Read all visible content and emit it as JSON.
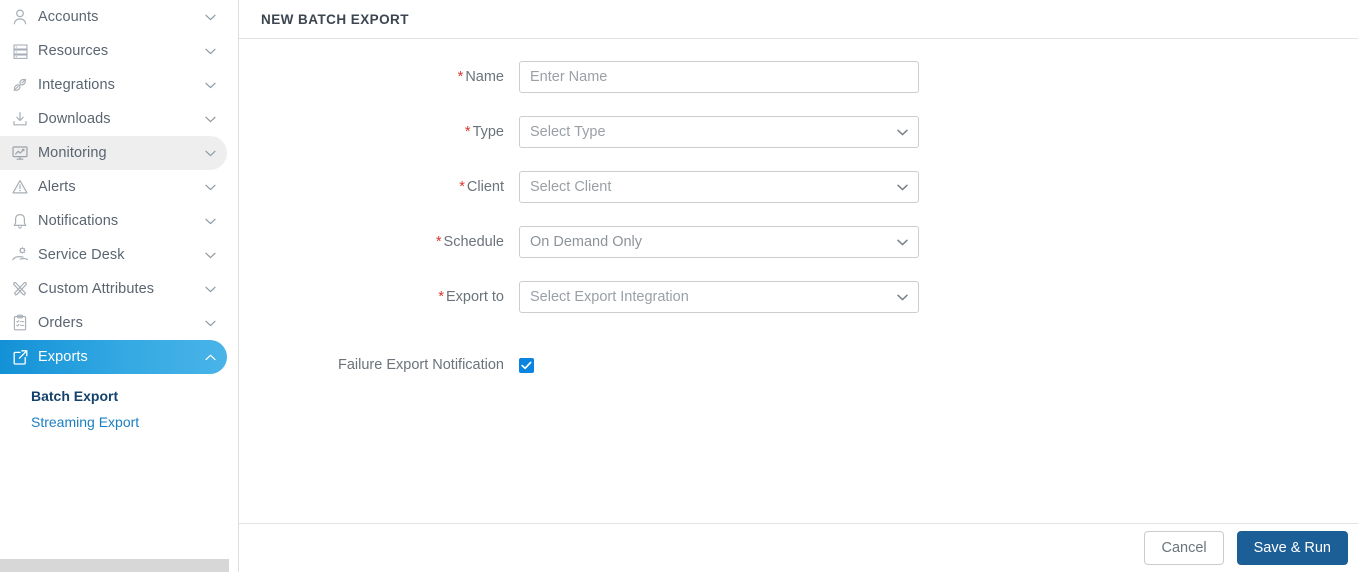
{
  "sidebar": {
    "items": [
      {
        "label": "Accounts",
        "icon": "user-icon",
        "chevron": "chevron-down-icon",
        "state": "normal"
      },
      {
        "label": "Resources",
        "icon": "server-icon",
        "chevron": "chevron-down-icon",
        "state": "normal"
      },
      {
        "label": "Integrations",
        "icon": "plug-icon",
        "chevron": "chevron-down-icon",
        "state": "normal"
      },
      {
        "label": "Downloads",
        "icon": "download-icon",
        "chevron": "chevron-down-icon",
        "state": "normal"
      },
      {
        "label": "Monitoring",
        "icon": "monitor-chart-icon",
        "chevron": "chevron-down-icon",
        "state": "hovered"
      },
      {
        "label": "Alerts",
        "icon": "warning-triangle-icon",
        "chevron": "chevron-down-icon",
        "state": "normal"
      },
      {
        "label": "Notifications",
        "icon": "bell-icon",
        "chevron": "chevron-down-icon",
        "state": "normal"
      },
      {
        "label": "Service Desk",
        "icon": "hand-gear-icon",
        "chevron": "chevron-down-icon",
        "state": "normal"
      },
      {
        "label": "Custom Attributes",
        "icon": "crossed-tools-icon",
        "chevron": "chevron-down-icon",
        "state": "normal"
      },
      {
        "label": "Orders",
        "icon": "clipboard-icon",
        "chevron": "chevron-down-icon",
        "state": "normal"
      },
      {
        "label": "Exports",
        "icon": "export-box-arrow-icon",
        "chevron": "chevron-up-icon",
        "state": "active"
      }
    ],
    "sub_items": [
      {
        "label": "Batch Export",
        "state": "selected"
      },
      {
        "label": "Streaming Export",
        "state": "link"
      }
    ],
    "active_color": "#34a9e3",
    "selected_sub_color": "#14426b",
    "link_color": "#1a7fc1"
  },
  "header": {
    "title": "NEW BATCH EXPORT"
  },
  "form": {
    "required_marker": "*",
    "required_color": "#d9352c",
    "fields": [
      {
        "label": "Name",
        "required": true,
        "control": "text",
        "value": "",
        "placeholder": "Enter Name"
      },
      {
        "label": "Type",
        "required": true,
        "control": "select",
        "value": "Select Type",
        "filled": false
      },
      {
        "label": "Client",
        "required": true,
        "control": "select",
        "value": "Select Client",
        "filled": false
      },
      {
        "label": "Schedule",
        "required": true,
        "control": "select",
        "value": "On Demand Only",
        "filled": true
      },
      {
        "label": "Export to",
        "required": true,
        "control": "select",
        "value": "Select Export Integration",
        "filled": false
      }
    ],
    "checkbox_row": {
      "label": "Failure Export Notification",
      "checked": true,
      "checked_color": "#0a84e0"
    }
  },
  "footer": {
    "cancel_label": "Cancel",
    "primary_label": "Save & Run",
    "primary_color": "#1c5f96"
  }
}
